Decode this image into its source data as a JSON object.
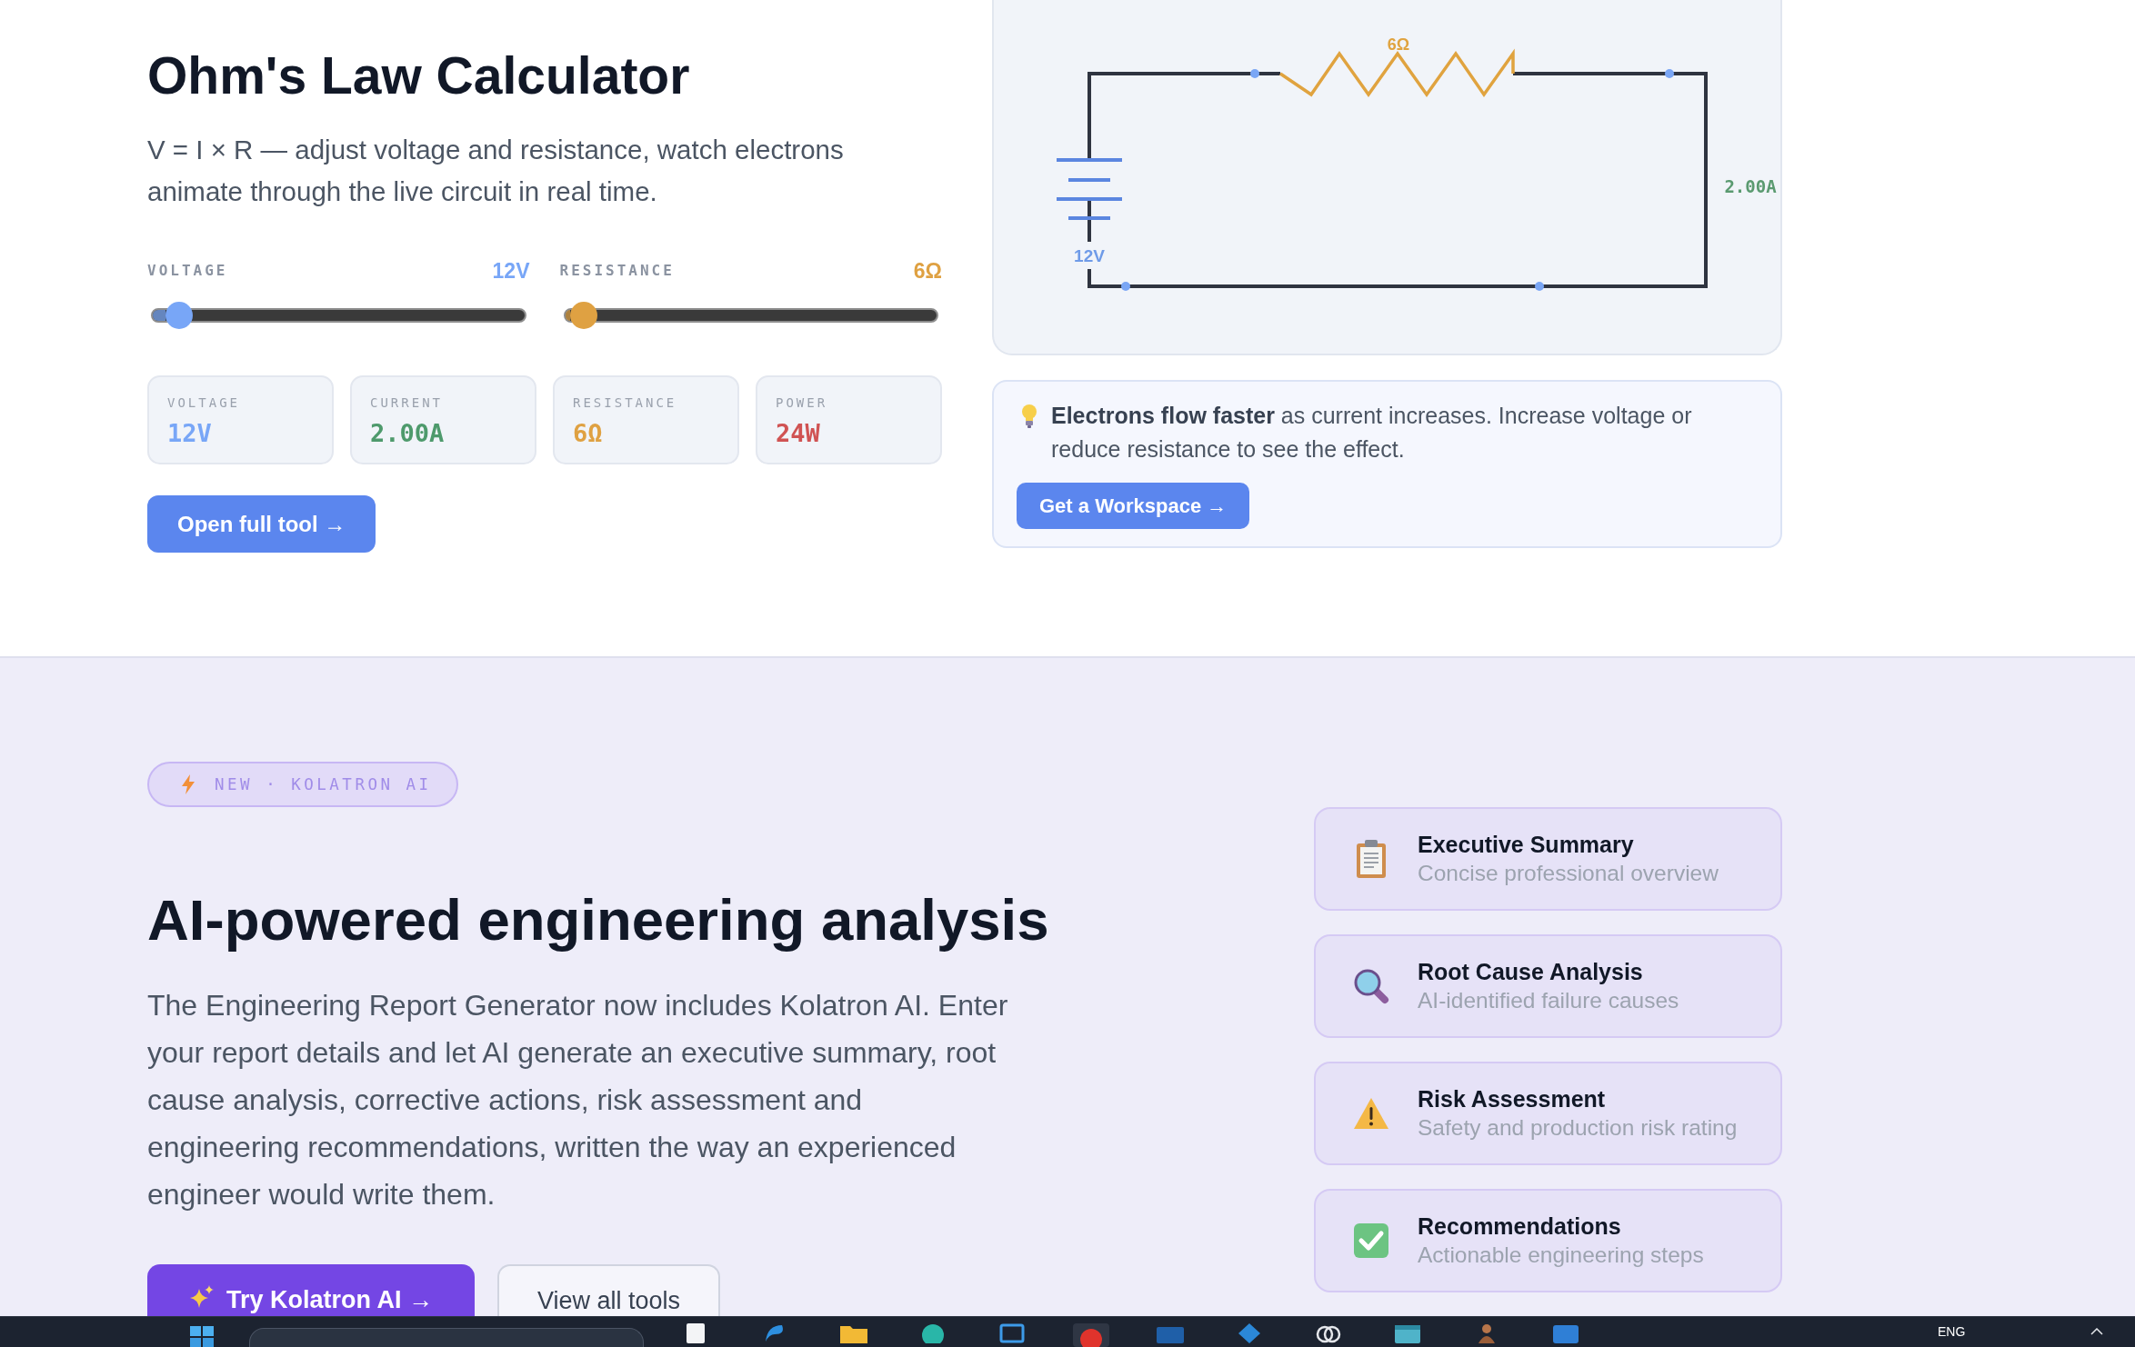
{
  "calculator": {
    "title": "Ohm's Law Calculator",
    "description": "V = I × R — adjust voltage and resistance, watch electrons animate through the live circuit in real time.",
    "sliders": [
      {
        "label": "VOLTAGE",
        "reading": "12V",
        "level": 0.07,
        "color": "#78a6f7"
      },
      {
        "label": "RESISTANCE",
        "reading": "6Ω",
        "level": 0.05,
        "color": "#dfa142"
      }
    ],
    "stats": [
      {
        "label": "VOLTAGE",
        "value": "12V",
        "color": "#78a6f7"
      },
      {
        "label": "CURRENT",
        "value": "2.00A",
        "color": "#4e9a6c"
      },
      {
        "label": "RESISTANCE",
        "value": "6Ω",
        "color": "#dfa142"
      },
      {
        "label": "POWER",
        "value": "24W",
        "color": "#d05353"
      }
    ],
    "button": "Open full tool →"
  },
  "circuit": {
    "resistor_label": "6Ω",
    "battery_label": "12V",
    "current_label": "2.00A"
  },
  "tip": {
    "text": "**Electrons flow faster** as current increases. Increase voltage or reduce resistance to see the effect.",
    "button": "Get a Workspace →"
  },
  "ai_section": {
    "badge": "NEW · KOLATRON AI",
    "heading": "AI-powered engineering analysis",
    "paragraph": "The Engineering Report Generator now includes Kolatron AI. Enter your report details and let AI generate an executive summary, root cause analysis, corrective actions, risk assessment and engineering recommendations, written the way an experienced engineer would write them.",
    "buttons": [
      {
        "label": "Try Kolatron AI →",
        "kind": "primary"
      },
      {
        "label": "View all tools",
        "kind": "secondary"
      }
    ],
    "features": [
      {
        "title": "Executive Summary",
        "subtitle": "Concise professional overview"
      },
      {
        "title": "Root Cause Analysis",
        "subtitle": "AI-identified failure causes"
      },
      {
        "title": "Risk Assessment",
        "subtitle": "Safety and production risk rating"
      },
      {
        "title": "Recommendations",
        "subtitle": "Actionable engineering steps"
      }
    ]
  },
  "taskbar": {
    "language": "ENG"
  }
}
